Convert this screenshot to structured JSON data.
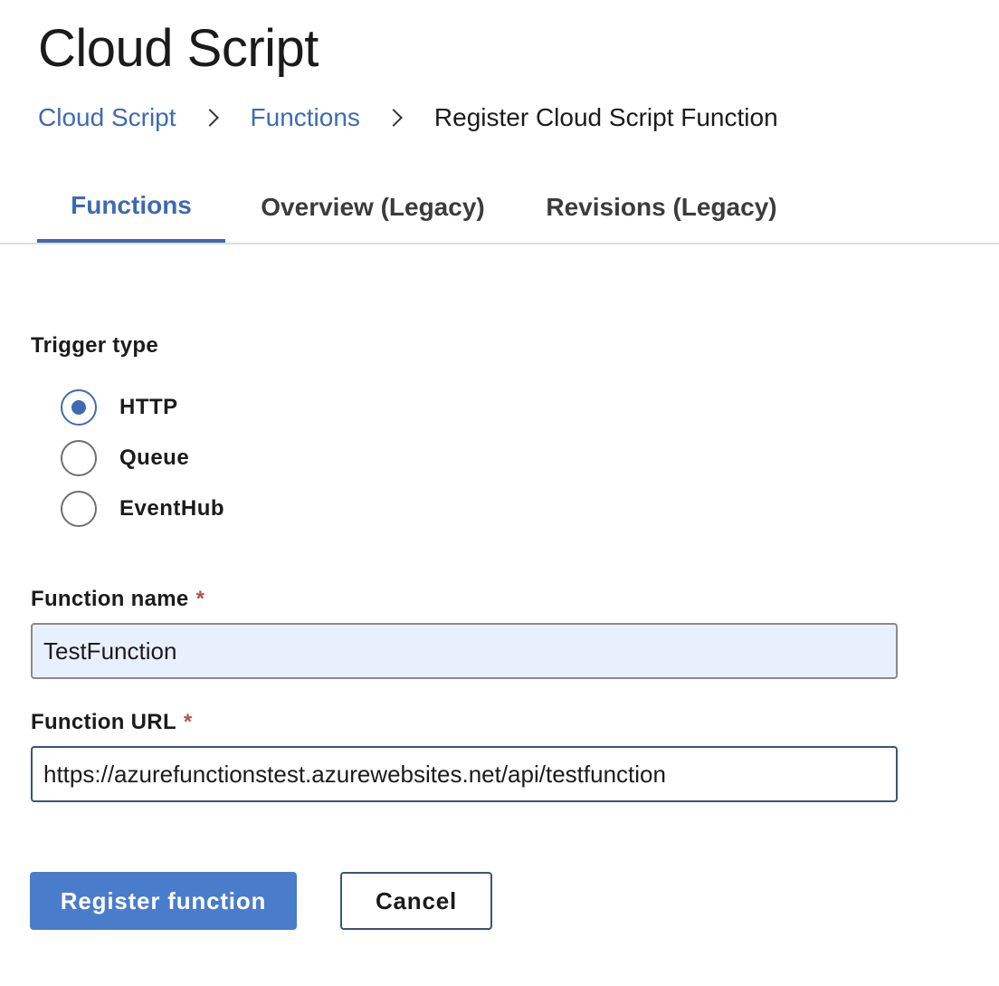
{
  "header": {
    "title": "Cloud Script"
  },
  "breadcrumb": {
    "items": [
      {
        "label": "Cloud Script"
      },
      {
        "label": "Functions"
      },
      {
        "label": "Register Cloud Script Function"
      }
    ]
  },
  "tabs": [
    {
      "label": "Functions",
      "active": true
    },
    {
      "label": "Overview (Legacy)",
      "active": false
    },
    {
      "label": "Revisions (Legacy)",
      "active": false
    }
  ],
  "form": {
    "trigger_type": {
      "label": "Trigger type",
      "options": [
        {
          "label": "HTTP",
          "selected": true
        },
        {
          "label": "Queue",
          "selected": false
        },
        {
          "label": "EventHub",
          "selected": false
        }
      ]
    },
    "function_name": {
      "label": "Function name",
      "required_mark": "*",
      "value": "TestFunction"
    },
    "function_url": {
      "label": "Function URL",
      "required_mark": "*",
      "value": "https://azurefunctionstest.azurewebsites.net/api/testfunction"
    },
    "register_label": "Register function",
    "cancel_label": "Cancel"
  },
  "colors": {
    "accent": "#3f6ab1",
    "primary_button": "#4a7ccc",
    "required": "#b1524c",
    "autofill_background": "#e9f0fd"
  }
}
